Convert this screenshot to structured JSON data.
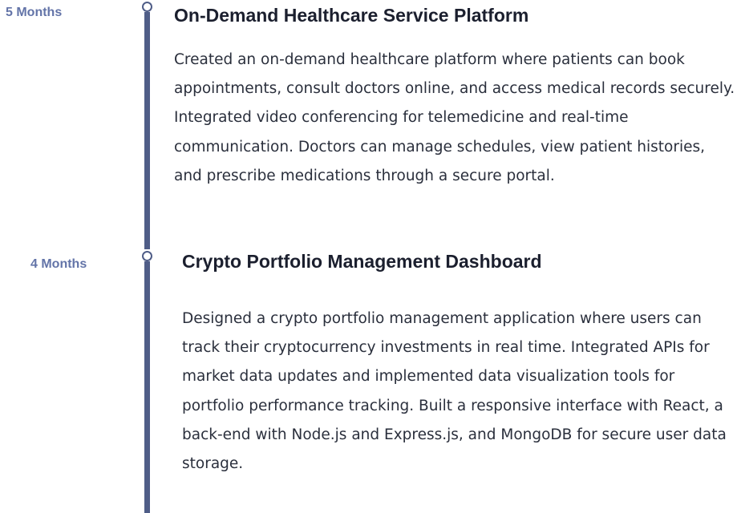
{
  "timeline": {
    "accent_color": "#4f5d87",
    "duration_color": "#6374a8",
    "projects": [
      {
        "duration": "5 Months",
        "title": "On-Demand Healthcare Service Platform",
        "description": "Created an on-demand healthcare platform where patients can book appointments, consult doctors online, and access medical records securely. Integrated video conferencing for telemedicine and real-time communication. Doctors can manage schedules, view patient histories, and prescribe medications through a secure portal."
      },
      {
        "duration": "4 Months",
        "title": "Crypto Portfolio Management Dashboard",
        "description": "Designed a crypto portfolio management application where users can track their cryptocurrency investments in real time. Integrated APIs for market data updates and implemented data visualization tools for portfolio performance tracking. Built a responsive interface with React, a back-end with Node.js and Express.js, and MongoDB for secure user data storage."
      }
    ]
  }
}
